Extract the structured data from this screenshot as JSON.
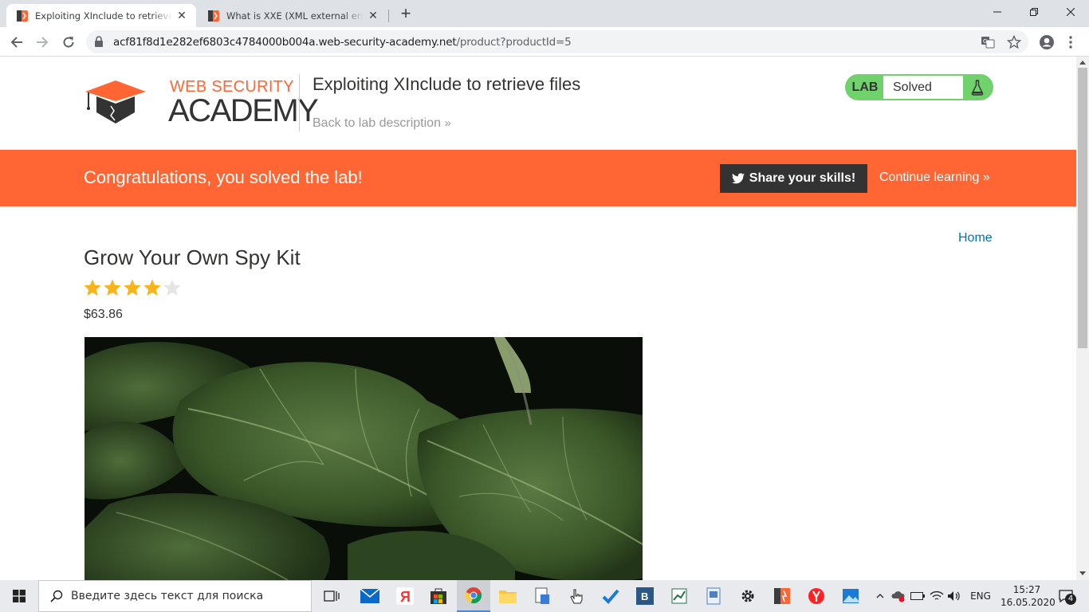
{
  "browser": {
    "tabs": [
      {
        "title": "Exploiting XInclude to retrieve file",
        "active": true
      },
      {
        "title": "What is XXE (XML external entity) i",
        "active": false
      }
    ],
    "url_host": "acf81f8d1e282ef6803c4784000b004a.web-security-academy.net",
    "url_path": "/product?productId=5"
  },
  "header": {
    "logo_top": "WEB SECURITY",
    "logo_bottom": "ACADEMY",
    "lab_title": "Exploiting XInclude to retrieve files",
    "back_link": "Back to lab description",
    "lab_label": "LAB",
    "lab_status": "Solved"
  },
  "banner": {
    "message": "Congratulations, you solved the lab!",
    "share_label": "Share your skills!",
    "continue_label": "Continue learning"
  },
  "product": {
    "home_link": "Home",
    "name": "Grow Your Own Spy Kit",
    "rating_out_of_5": 4,
    "price": "$63.86"
  },
  "taskbar": {
    "search_placeholder": "Введите здесь текст для поиска",
    "language": "ENG",
    "time": "15:27",
    "date": "16.05.2020",
    "notification_count": "4"
  },
  "colors": {
    "brand_orange": "#ff6633",
    "lab_green": "#70d16d",
    "link_blue": "#0071bc",
    "star_gold": "#f8b41b"
  }
}
